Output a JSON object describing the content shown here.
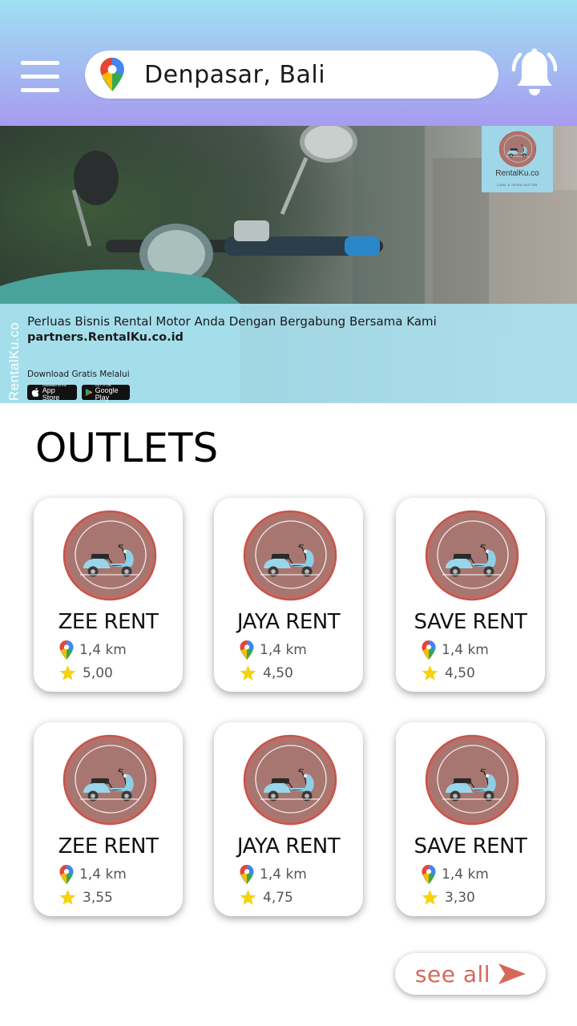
{
  "header": {
    "location": "Denpasar, Bali",
    "icons": {
      "menu": "hamburger-menu-icon",
      "location": "map-pin-icon",
      "notifications": "bell-icon"
    },
    "colors": {
      "gradient_top": "#9fe0f3",
      "gradient_bottom": "#a79bf0"
    }
  },
  "banner": {
    "logo_name": "RentalKu.co",
    "logo_tag": "CARI & SEWA MOTOR",
    "vertical_brand": "RentalKu.co",
    "headline": "Perluas Bisnis Rental Motor Anda Dengan Bergabung Bersama Kami",
    "link": "partners.RentalKu.co.id",
    "download_label": "Download Gratis Melalui",
    "app_store_small": "Download on the",
    "app_store": "App Store",
    "google_play_small": "GET IT ON",
    "google_play": "Google Play"
  },
  "outlets": {
    "title": "OUTLETS",
    "items": [
      {
        "name": "ZEE RENT",
        "distance": "1,4 km",
        "rating": "5,00"
      },
      {
        "name": "JAYA RENT",
        "distance": "1,4 km",
        "rating": "4,50"
      },
      {
        "name": "SAVE RENT",
        "distance": "1,4 km",
        "rating": "4,50"
      },
      {
        "name": "ZEE RENT",
        "distance": "1,4 km",
        "rating": "3,55"
      },
      {
        "name": "JAYA RENT",
        "distance": "1,4 km",
        "rating": "4,75"
      },
      {
        "name": "SAVE RENT",
        "distance": "1,4 km",
        "rating": "3,30"
      }
    ]
  },
  "see_all": {
    "label": "see all",
    "color": "#d4695a"
  }
}
